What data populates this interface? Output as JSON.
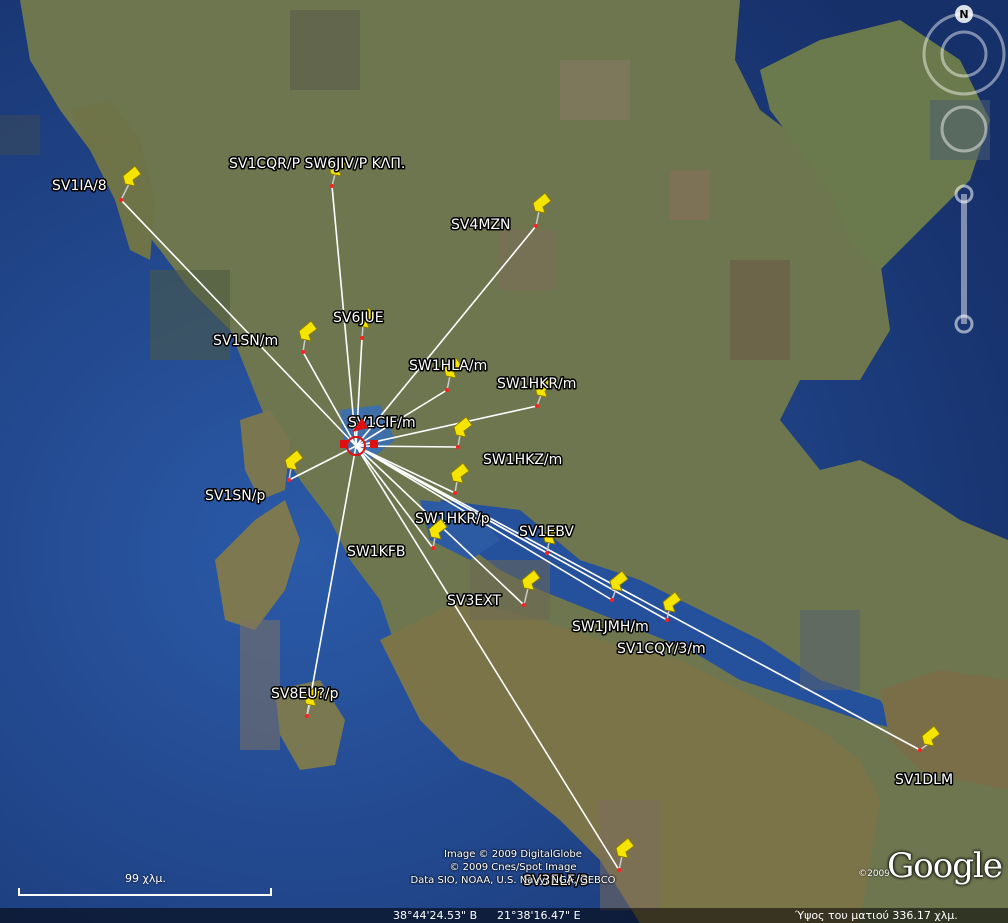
{
  "map": {
    "center_marker": "SV1CIF/m",
    "pins": [
      {
        "id": "sv1ia8",
        "label": "SV1IA/8"
      },
      {
        "id": "sv1cqr",
        "label": "SV1CQR/P SW6JIV/P ΚΛΠ."
      },
      {
        "id": "sv4mzn",
        "label": "SV4MZN"
      },
      {
        "id": "sv6jue",
        "label": "SV6JUE"
      },
      {
        "id": "sv1snm",
        "label": "SV1SN/m"
      },
      {
        "id": "sw1hlam",
        "label": "SW1HLA/m"
      },
      {
        "id": "sw1hkrm",
        "label": "SW1HKR/m"
      },
      {
        "id": "sv1cifm",
        "label": "SV1CIF/m"
      },
      {
        "id": "sw1hkzm",
        "label": "SW1HKZ/m"
      },
      {
        "id": "sv1snp",
        "label": "SV1SN/p"
      },
      {
        "id": "sw1hkrp",
        "label": "SW1HKR/p"
      },
      {
        "id": "sv1ebv",
        "label": "SV1EBV"
      },
      {
        "id": "sw1kfb",
        "label": "SW1KFB"
      },
      {
        "id": "sv3ext",
        "label": "SV3EXT"
      },
      {
        "id": "sw1jmhm",
        "label": "SW1JMH/m"
      },
      {
        "id": "sv1cqy3m",
        "label": "SV1CQY/3/m"
      },
      {
        "id": "sv8eup",
        "label": "SV8EU?/p"
      },
      {
        "id": "sv1dlm",
        "label": "SV1DLM"
      },
      {
        "id": "sv3elf3",
        "label": "SV3ELF/3"
      }
    ],
    "colors": {
      "sea": "#1f4590",
      "land": "#6d7a4e",
      "link_line": "#ffffff",
      "pin": "#f5e400",
      "center": "#e01010"
    }
  },
  "credits": {
    "line1": "Image © 2009 DigitalGlobe",
    "line2": "© 2009 Cnes/Spot Image",
    "line3": "Data SIO, NOAA, U.S. Navy, NGA, GEBCO"
  },
  "logo": {
    "text": "Google",
    "year": "©2009"
  },
  "scale": {
    "label": "99 χλμ."
  },
  "status": {
    "lat": "38°44'24.53\" Β",
    "lon": "21°38'16.47\" Ε",
    "eye_alt": "Ύψος του ματιού  336.17 χλμ."
  },
  "nav": {
    "north": "N"
  }
}
